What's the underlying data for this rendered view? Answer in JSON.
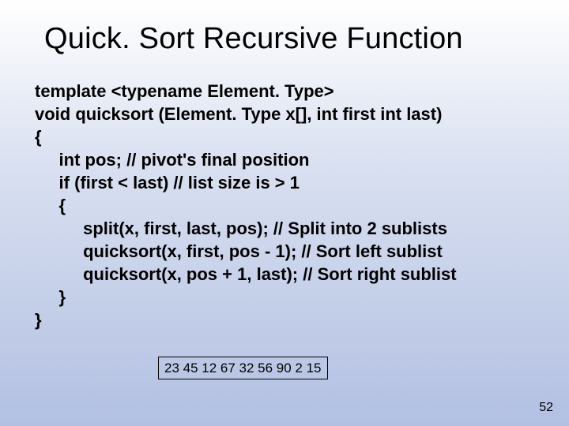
{
  "title": "Quick. Sort Recursive Function",
  "code": {
    "l1": "template <typename Element. Type>",
    "l2": "void quicksort (Element. Type x[], int first int last)",
    "l3": "{",
    "l4": "     int pos; // pivot's final position",
    "l5": "     if (first < last) // list size is > 1",
    "l6": "     {",
    "l7": "          split(x, first, last, pos); // Split into 2 sublists",
    "l8": "          quicksort(x, first, pos - 1); // Sort left sublist",
    "l9": "          quicksort(x, pos + 1, last); // Sort right sublist",
    "l10": "     }",
    "l11": "}"
  },
  "numbers": "23 45 12 67 32 56 90 2 15",
  "page_number": "52"
}
